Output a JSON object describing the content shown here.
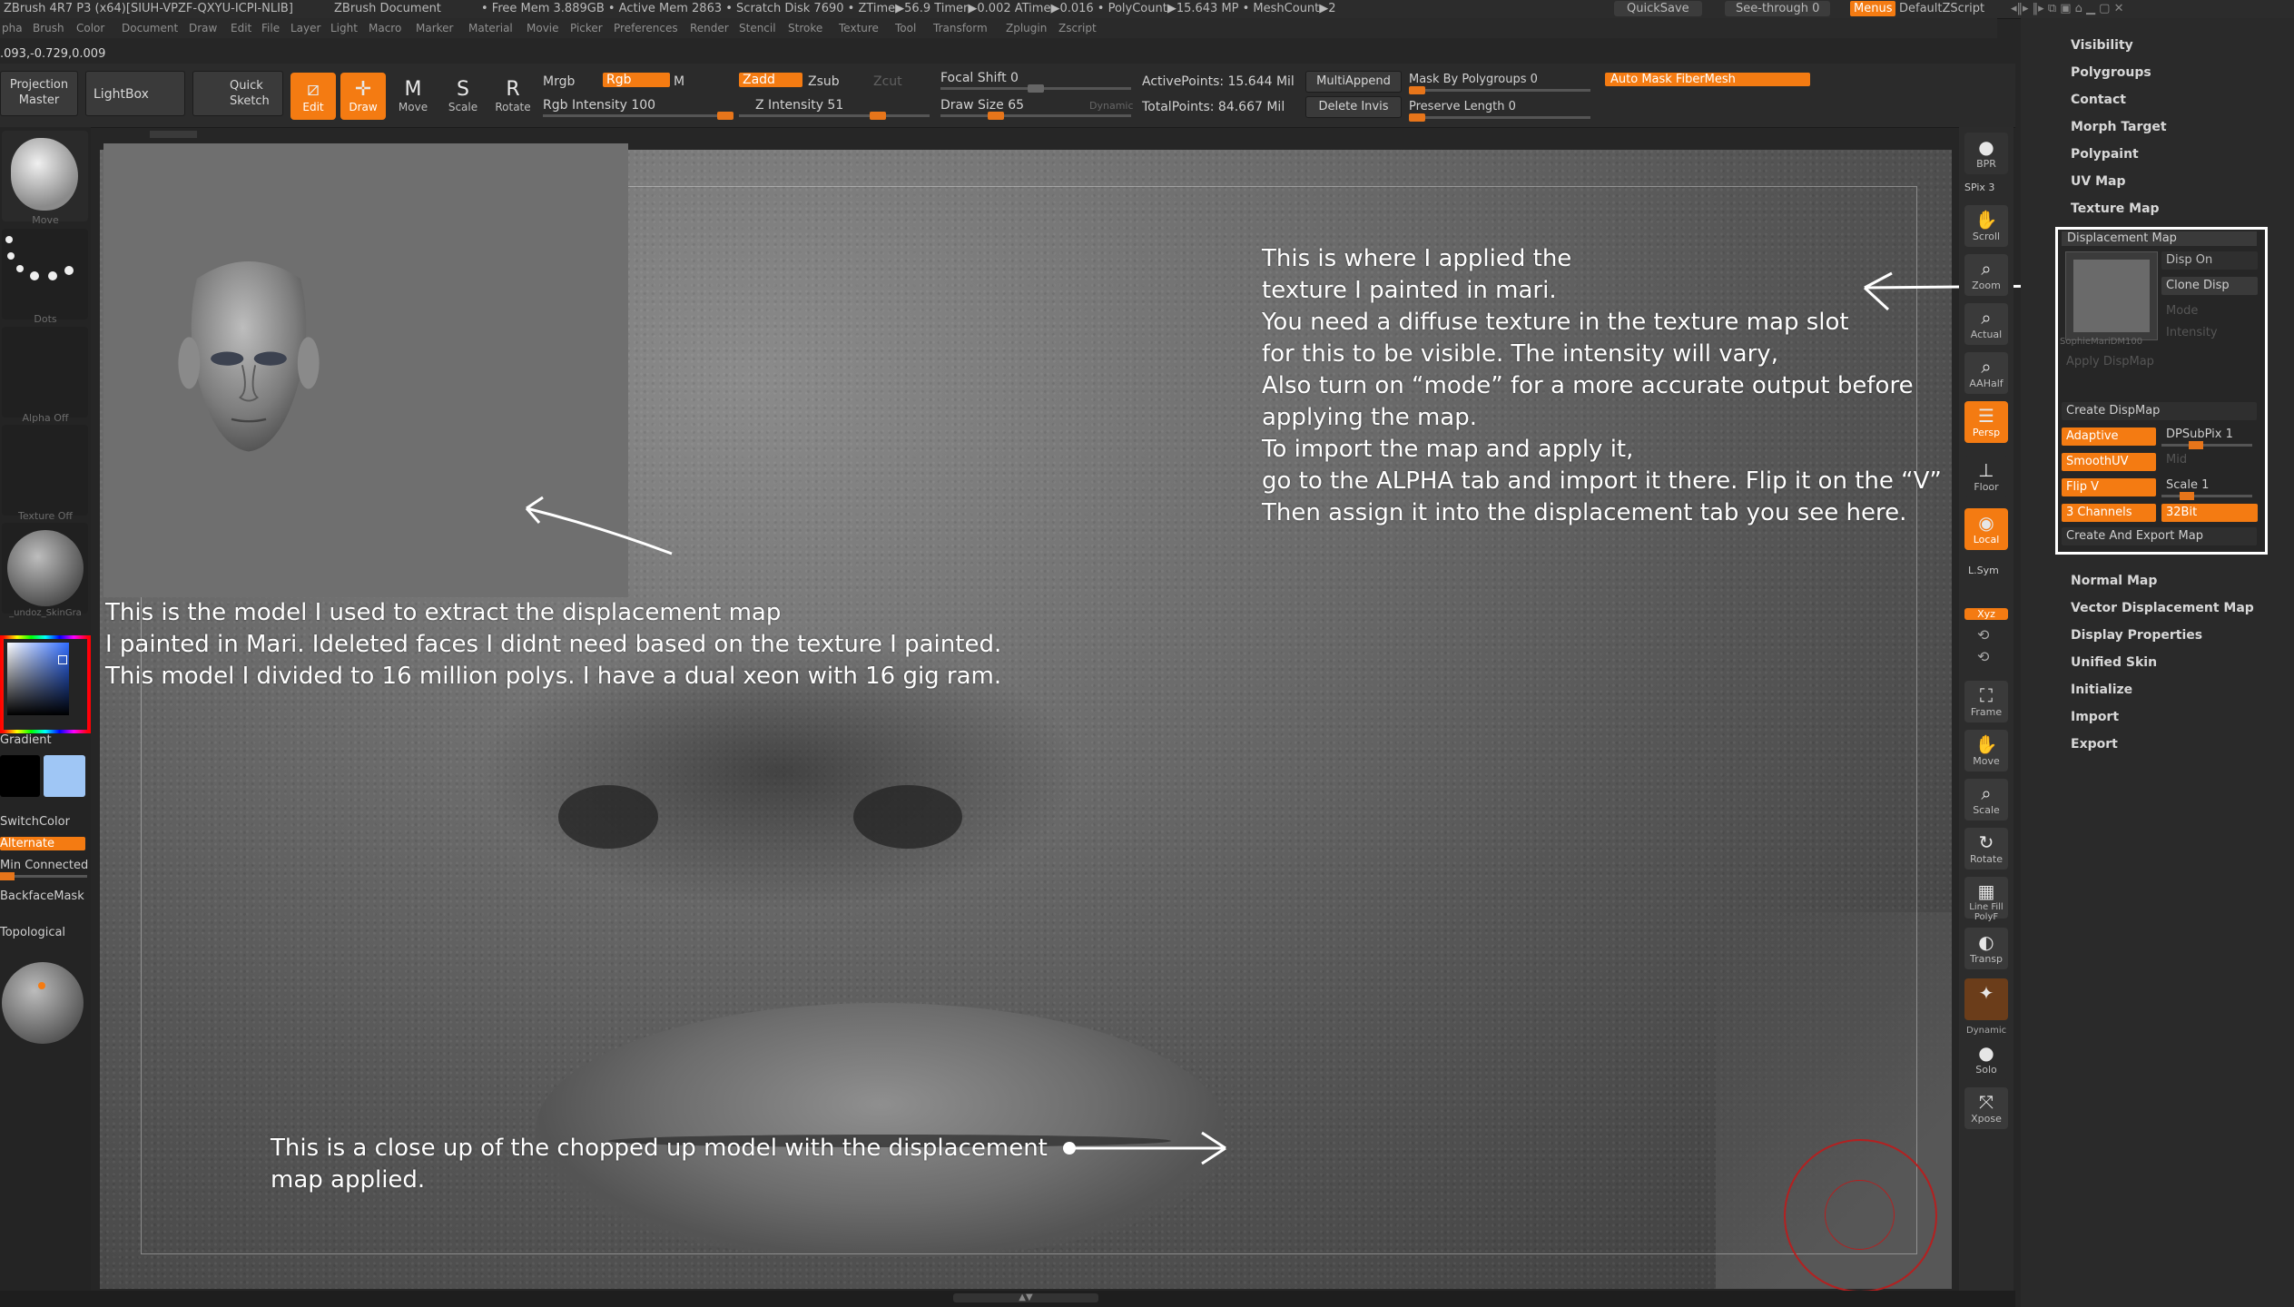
{
  "title_bar": {
    "app": "ZBrush 4R7 P3 (x64)[SIUH-VPZF-QXYU-ICPI-NLIB]",
    "document": "ZBrush Document",
    "stats": "• Free Mem 3.889GB • Active Mem 2863 • Scratch Disk 7690 • ZTime▶56.9 Timer▶0.002 ATime▶0.016 • PolyCount▶15.643 MP • MeshCount▶2",
    "quicksave": "QuickSave",
    "see_through": "See-through  0",
    "menus": "Menus",
    "script": "DefaultZScript"
  },
  "menu_bar": [
    "pha",
    "Brush",
    "Color",
    "Document",
    "Draw",
    "Edit",
    "File",
    "Layer",
    "Light",
    "Macro",
    "Marker",
    "Material",
    "Movie",
    "Picker",
    "Preferences",
    "Render",
    "Stencil",
    "Stroke",
    "Texture",
    "Tool",
    "Transform",
    "Zplugin",
    "Zscript"
  ],
  "coords": ".093,-0.729,0.009",
  "toolbar": {
    "projection_master": "Projection Master",
    "lightbox": "LightBox",
    "quick_sketch": "Quick Sketch",
    "edit": "Edit",
    "draw": "Draw",
    "move": "Move",
    "scale": "Scale",
    "rotate": "Rotate",
    "mrgb": "Mrgb",
    "rgb": "Rgb",
    "m": "M",
    "rgb_intensity": "Rgb Intensity 100",
    "zadd": "Zadd",
    "zsub": "Zsub",
    "zcut": "Zcut",
    "z_intensity": "Z Intensity 51",
    "focal_shift": "Focal Shift 0",
    "draw_size": "Draw Size 65",
    "dynamic": "Dynamic",
    "active_points": "ActivePoints: 15.644 Mil",
    "total_points": "TotalPoints: 84.667 Mil",
    "multi_append": "MultiAppend",
    "delete_invis": "Delete Invis",
    "mask_by_polygroups": "Mask By Polygroups 0",
    "preserve_length": "Preserve Length 0",
    "auto_mask_fibermesh": "Auto Mask FiberMesh"
  },
  "left_shelf": {
    "brush": "Move",
    "stroke": "Dots",
    "alpha": "Alpha Off",
    "texture": "Texture Off",
    "material": "_undoz_SkinGra",
    "gradient": "Gradient",
    "switch_color": "SwitchColor",
    "alternate": "Alternate",
    "min_connected": "Min Connected",
    "backface_mask": "BackfaceMask",
    "topological": "Topological"
  },
  "notes": {
    "model_note": "This is the model I used to extract the displacement map\nI painted in Mari. Ideleted faces I didnt need based on the texture I painted.\nThis model I divided to 16 million polys. I have a dual xeon with 16 gig ram.",
    "texture_note": "This is where I applied the\ntexture I painted in mari.\nYou need a diffuse texture in the texture map slot\nfor this to be visible. The intensity will vary,\nAlso turn on “mode” for a more accurate output before\napplying the map.\nTo import the map and apply it,\ngo to the ALPHA tab and import it there. Flip it on the “V”\nThen assign it into the displacement tab you see here.",
    "closeup_note": "This is a close up of the chopped up model with the displacement\nmap applied."
  },
  "right_strip": [
    "BPR",
    "SPix 3",
    "Scroll",
    "Zoom",
    "Actual",
    "AAHalf",
    "Persp",
    "Floor",
    "Local",
    "L.Sym",
    "Xyz",
    "Frame",
    "Move",
    "Scale",
    "Rotate",
    "Line Fill PolyF",
    "Transp",
    "Dynamic",
    "Solo",
    "Xpose"
  ],
  "right_palette": {
    "items_top": [
      "Visibility",
      "Polygroups",
      "Contact",
      "Morph Target",
      "Polypaint",
      "UV Map",
      "Texture Map"
    ],
    "disp_title": "Displacement Map",
    "disp_on": "Disp On",
    "clone_disp": "Clone Disp",
    "mode": "Mode",
    "intensity": "Intensity",
    "thumb_name": "SophieMariDM100",
    "apply_dispmap": "Apply DispMap",
    "create_dispmap": "Create DispMap",
    "adaptive": "Adaptive",
    "dpsubpix": "DPSubPix 1",
    "smoothuv": "SmoothUV",
    "mid": "Mid",
    "flip_v": "Flip V",
    "scale": "Scale 1",
    "channels": "3 Channels",
    "bits": "32Bit",
    "create_export": "Create And Export Map",
    "items_bottom": [
      "Normal Map",
      "Vector Displacement Map",
      "Display Properties",
      "Unified Skin",
      "Initialize",
      "Import",
      "Export"
    ]
  },
  "colors": {
    "accent": "#f47b12",
    "secondary_color": "#9fc6f5"
  }
}
